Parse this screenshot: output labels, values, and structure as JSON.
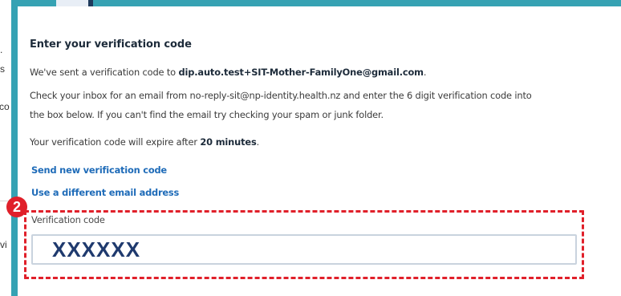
{
  "background_fragments": [
    ".",
    "s",
    "co",
    "vi"
  ],
  "dialog": {
    "title": "Enter your verification code",
    "sent_prefix": "We've sent a verification code to ",
    "email": "dip.auto.test+SIT-Mother-FamilyOne@gmail.com",
    "sent_suffix": ".",
    "instructions_line1": "Check your inbox for an email from no-reply-sit@np-identity.health.nz and enter the 6 digit verification code into",
    "instructions_line2": "the box below. If you can't find the email try checking your spam or junk folder.",
    "expiry_prefix": "Your verification code will expire after ",
    "expiry_time": "20 minutes",
    "expiry_suffix": ".",
    "send_new_link": "Send new verification code",
    "different_email_link": "Use a different email address",
    "code_label": "Verification code",
    "code_value": "XXXXXX"
  },
  "annotation": {
    "step_number": "2"
  },
  "colors": {
    "frame_teal": "#36a2b3",
    "link_blue": "#1e6bb8",
    "highlight_red": "#e0202a",
    "code_text": "#1f3a6e"
  }
}
